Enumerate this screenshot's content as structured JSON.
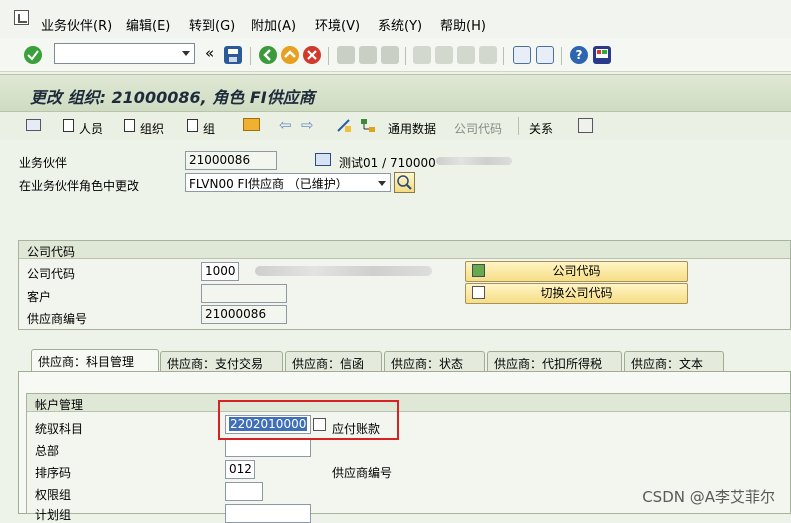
{
  "menu": {
    "items": [
      "业务伙伴(R)",
      "编辑(E)",
      "转到(G)",
      "附加(A)",
      "环境(V)",
      "系统(Y)",
      "帮助(H)"
    ]
  },
  "toolbar": {
    "command_field_value": "",
    "icons": [
      "enter-icon",
      "save-icon",
      "back-icon",
      "exit-icon",
      "cancel-icon",
      "print-icon",
      "find-icon",
      "find-next-icon",
      "first-page-icon",
      "prev-page-icon",
      "next-page-icon",
      "last-page-icon",
      "new-session-icon",
      "shortcut-icon",
      "help-icon",
      "customize-icon"
    ]
  },
  "title": "更改 组织: 21000086, 角色 FI供应商",
  "app_toolbar": {
    "person": "人员",
    "organization": "组织",
    "group": "组",
    "general_data": "通用数据",
    "company_code": "公司代码",
    "relationships": "关系"
  },
  "header": {
    "bp_label": "业务伙伴",
    "bp_value": "21000086",
    "bp_desc": "测试01 / 710000",
    "role_label": "在业务伙伴角色中更改",
    "role_value": "FLVN00 FI供应商 （已维护）"
  },
  "company_section": {
    "title": "公司代码",
    "company_code_label": "公司代码",
    "company_code_value": "1000",
    "customer_label": "客户",
    "customer_value": "",
    "vendor_no_label": "供应商编号",
    "vendor_no_value": "21000086",
    "company_code_button": "公司代码",
    "switch_button": "切换公司代码"
  },
  "tabs": [
    "供应商：科目管理",
    "供应商：支付交易",
    "供应商：信函",
    "供应商：状态",
    "供应商：代扣所得税",
    "供应商：文本"
  ],
  "account_mgmt": {
    "title": "帐户管理",
    "recon_label": "统驭科目",
    "recon_value": "2202010000",
    "recon_desc": "应付账款",
    "head_office_label": "总部",
    "head_office_value": "",
    "sort_key_label": "排序码",
    "sort_key_value": "012",
    "sort_key_desc": "供应商编号",
    "auth_group_label": "权限组",
    "auth_group_value": "",
    "planning_group_label": "计划组"
  },
  "watermark": "CSDN @A李艾菲尔",
  "colors": {
    "highlight": "#d62222",
    "button": "#f6de86"
  }
}
